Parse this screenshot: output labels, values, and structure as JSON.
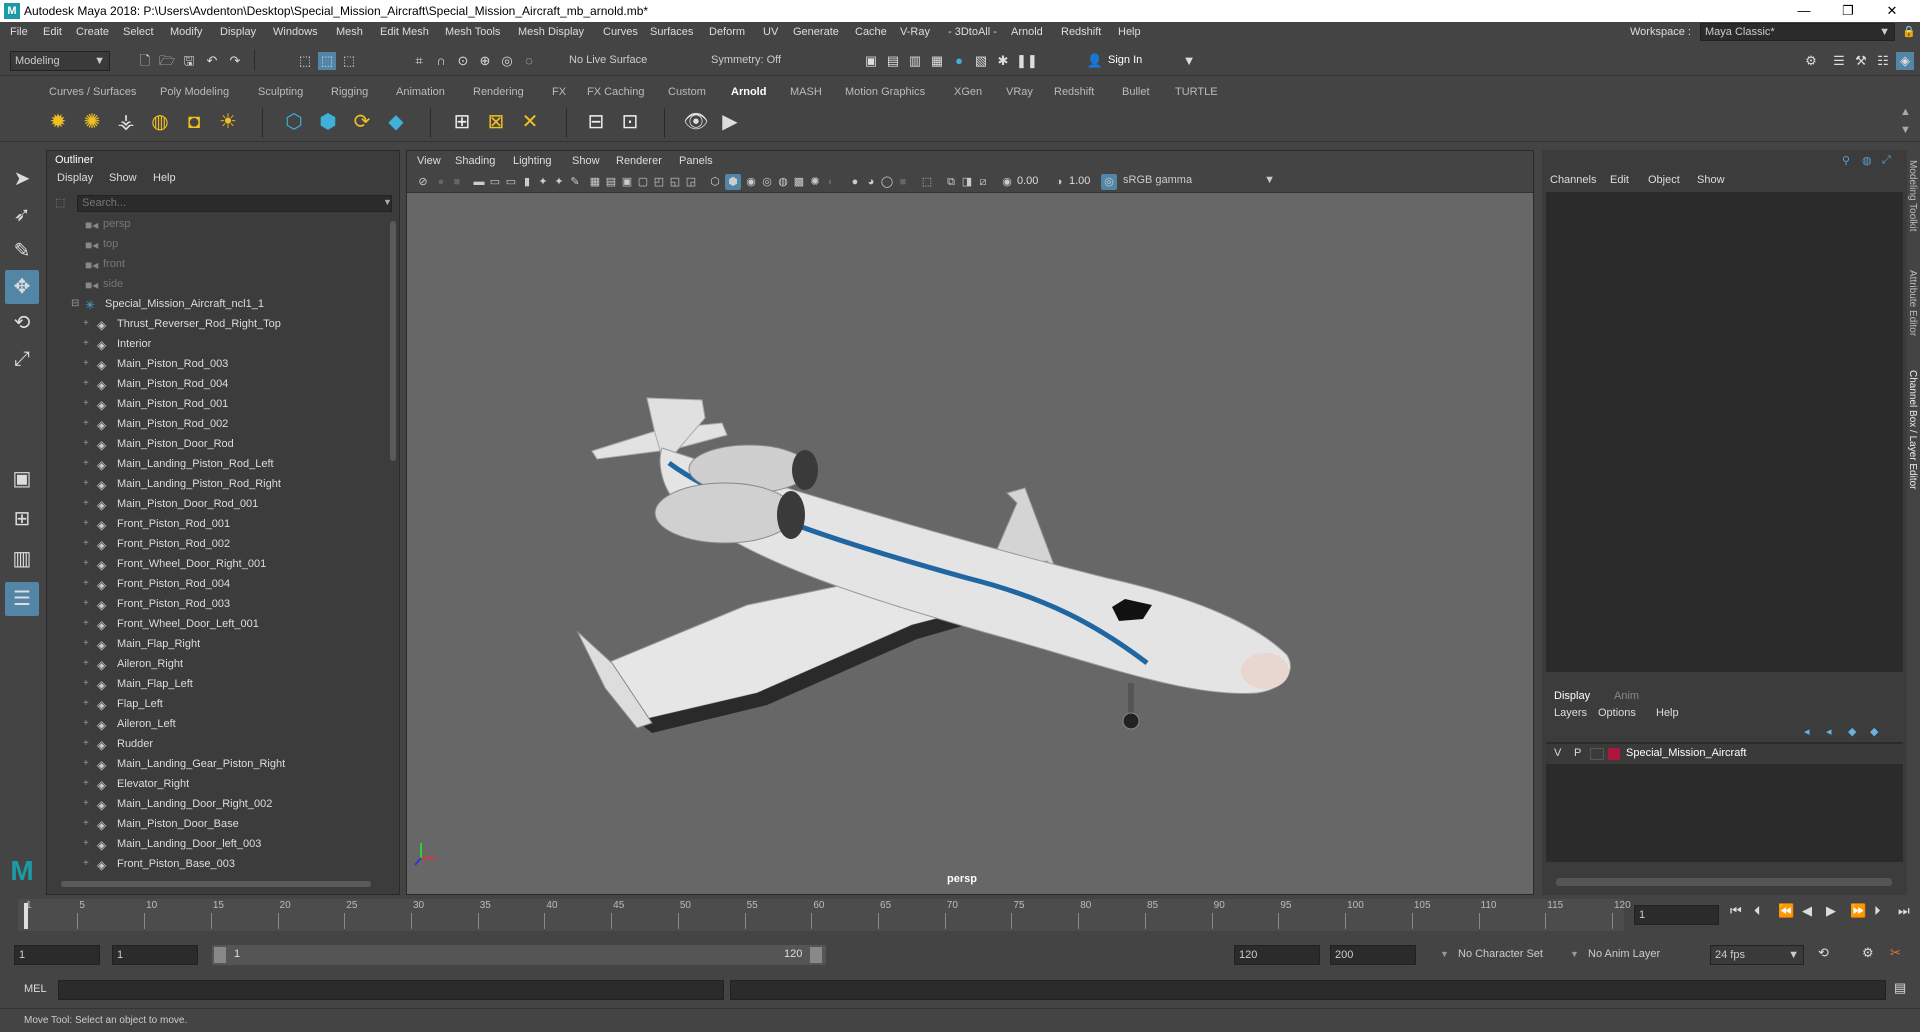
{
  "window": {
    "title": "Autodesk Maya 2018: P:\\Users\\Avdenton\\Desktop\\Special_Mission_Aircraft\\Special_Mission_Aircraft_mb_arnold.mb*",
    "logo": "M"
  },
  "menubar": [
    "File",
    "Edit",
    "Create",
    "Select",
    "Modify",
    "Display",
    "Windows",
    "Mesh",
    "Edit Mesh",
    "Mesh Tools",
    "Mesh Display",
    "Curves",
    "Surfaces",
    "Deform",
    "UV",
    "Generate",
    "Cache",
    "V-Ray",
    "- 3DtoAll -",
    "Arnold",
    "Redshift",
    "Help"
  ],
  "workspace": {
    "label": "Workspace :",
    "value": "Maya Classic*"
  },
  "statusline": {
    "mode": "Modeling",
    "live_surface": "No Live Surface",
    "symmetry": "Symmetry: Off",
    "sign_in": "Sign In"
  },
  "shelf_tabs": [
    "Curves / Surfaces",
    "Poly Modeling",
    "Sculpting",
    "Rigging",
    "Animation",
    "Rendering",
    "FX",
    "FX Caching",
    "Custom",
    "Arnold",
    "MASH",
    "Motion Graphics",
    "XGen",
    "VRay",
    "Redshift",
    "Bullet",
    "TURTLE"
  ],
  "active_shelf": "Arnold",
  "outliner": {
    "tab": "Outliner",
    "menus": [
      "Display",
      "Show",
      "Help"
    ],
    "search_placeholder": "Search...",
    "cameras": [
      "persp",
      "top",
      "front",
      "side"
    ],
    "root": "Special_Mission_Aircraft_ncl1_1",
    "items": [
      "Thrust_Reverser_Rod_Right_Top",
      "Interior",
      "Main_Piston_Rod_003",
      "Main_Piston_Rod_004",
      "Main_Piston_Rod_001",
      "Main_Piston_Rod_002",
      "Main_Piston_Door_Rod",
      "Main_Landing_Piston_Rod_Left",
      "Main_Landing_Piston_Rod_Right",
      "Main_Piston_Door_Rod_001",
      "Front_Piston_Rod_001",
      "Front_Piston_Rod_002",
      "Front_Wheel_Door_Right_001",
      "Front_Piston_Rod_004",
      "Front_Piston_Rod_003",
      "Front_Wheel_Door_Left_001",
      "Main_Flap_Right",
      "Aileron_Right",
      "Main_Flap_Left",
      "Flap_Left",
      "Aileron_Left",
      "Rudder",
      "Main_Landing_Gear_Piston_Right",
      "Elevator_Right",
      "Main_Landing_Door_Right_002",
      "Main_Piston_Door_Base",
      "Main_Landing_Door_left_003",
      "Front_Piston_Base_003"
    ]
  },
  "viewport": {
    "menus": [
      "View",
      "Shading",
      "Lighting",
      "Show",
      "Renderer",
      "Panels"
    ],
    "exposure": "0.00",
    "gamma": "1.00",
    "color_space": "sRGB gamma",
    "camera_label": "persp"
  },
  "channelbox": {
    "menus": [
      "Channels",
      "Edit",
      "Object",
      "Show"
    ],
    "layer_tabs": [
      "Display",
      "Anim"
    ],
    "layer_menus": [
      "Layers",
      "Options",
      "Help"
    ],
    "layer": {
      "v": "V",
      "p": "P",
      "name": "Special_Mission_Aircraft",
      "color": "#b0143c"
    },
    "side_tabs": [
      "Modeling Toolkit",
      "Attribute Editor",
      "Channel Box / Layer Editor"
    ]
  },
  "timeline": {
    "ticks": [
      "1",
      "5",
      "10",
      "15",
      "20",
      "25",
      "30",
      "35",
      "40",
      "45",
      "50",
      "55",
      "60",
      "65",
      "70",
      "75",
      "80",
      "85",
      "90",
      "95",
      "100",
      "105",
      "110",
      "115",
      "120"
    ],
    "current_frame": "1"
  },
  "range": {
    "start": "1",
    "playback_start": "1",
    "slider_start": "1",
    "slider_end": "120",
    "playback_end": "120",
    "end": "200",
    "character_set": "No Character Set",
    "anim_layer": "No Anim Layer",
    "fps": "24 fps"
  },
  "cmdline": {
    "label": "MEL"
  },
  "helpline": {
    "text": "Move Tool: Select an object to move."
  },
  "colors": {
    "accent": "#5285a6",
    "viewport_bg": "#676767",
    "panel_bg": "#444444"
  }
}
